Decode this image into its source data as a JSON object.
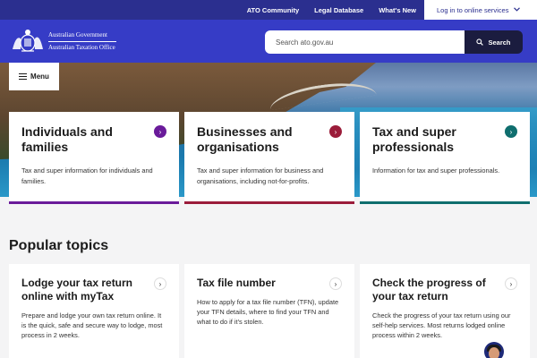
{
  "topbar": {
    "links": [
      "ATO Community",
      "Legal Database",
      "What's New"
    ],
    "login_label": "Log in to online services"
  },
  "header": {
    "logo_line1": "Australian Government",
    "logo_line2": "Australian Taxation Office",
    "search_placeholder": "Search ato.gov.au",
    "search_button": "Search"
  },
  "menu_label": "Menu",
  "audience_cards": [
    {
      "title": "Individuals and families",
      "description": "Tax and super information for individuals and families.",
      "accent": "#6a1b9a"
    },
    {
      "title": "Businesses and organisations",
      "description": "Tax and super information for business and organisations, including not-for-profits.",
      "accent": "#9b1c3a"
    },
    {
      "title": "Tax and super professionals",
      "description": "Information for tax and super professionals.",
      "accent": "#0f6e6e"
    }
  ],
  "popular": {
    "heading": "Popular topics",
    "cards": [
      {
        "title": "Lodge your tax return online with myTax",
        "description": "Prepare and lodge your own tax return online. It is the quick, safe and secure way to lodge, most process in 2 weeks."
      },
      {
        "title": "Tax file number",
        "description": "How to apply for a tax file number (TFN), update your TFN details, where to find your TFN and what to do if it's stolen."
      },
      {
        "title": "Check the progress of your tax return",
        "description": "Check the progress of your tax return using our self-help services. Most returns lodged online process within 2 weeks."
      }
    ]
  }
}
